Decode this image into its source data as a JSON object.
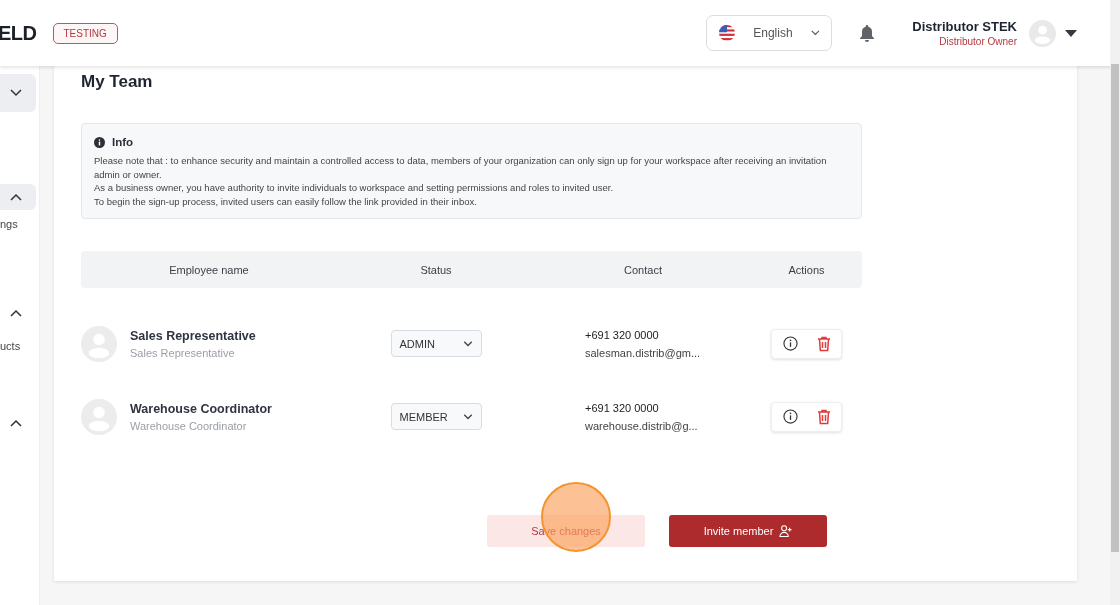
{
  "header": {
    "logo": "ELD",
    "badge": "TESTING",
    "language": {
      "label": "English"
    },
    "user": {
      "name": "Distributor STEK",
      "role": "Distributor Owner"
    }
  },
  "sidebar": {
    "groups": [
      {
        "expanded": false,
        "selected": true
      },
      {
        "expanded": true,
        "selected": true,
        "child": "ngs"
      },
      {
        "expanded": true,
        "selected": false,
        "child": "ucts"
      },
      {
        "expanded": true,
        "selected": false
      }
    ]
  },
  "page_title": "My Team",
  "info": {
    "title": "Info",
    "paragraphs": [
      "Please note that : to enhance security and maintain a controlled access to data, members of your organization can only sign up for your workspace after receiving an invitation admin or owner.",
      "As a business owner, you have authority to invite individuals to workspace and setting permissions and roles to invited user.",
      "To begin the sign-up process, invited users can easily follow the link provided in their inbox."
    ]
  },
  "table": {
    "columns": [
      "Employee name",
      "Status",
      "Contact",
      "Actions"
    ],
    "rows": [
      {
        "name": "Sales Representative",
        "subtitle": "Sales Representative",
        "status": "ADMIN",
        "phone": "+691 320 0000",
        "email": "salesman.distrib@gm..."
      },
      {
        "name": "Warehouse Coordinator",
        "subtitle": "Warehouse Coordinator",
        "status": "MEMBER",
        "phone": "+691 320 0000",
        "email": "warehouse.distrib@g..."
      }
    ]
  },
  "buttons": [
    {
      "kind": "secondary",
      "label": "Save changes",
      "disabled": true
    },
    {
      "kind": "primary",
      "label": "Invite member",
      "disabled": false
    }
  ]
}
